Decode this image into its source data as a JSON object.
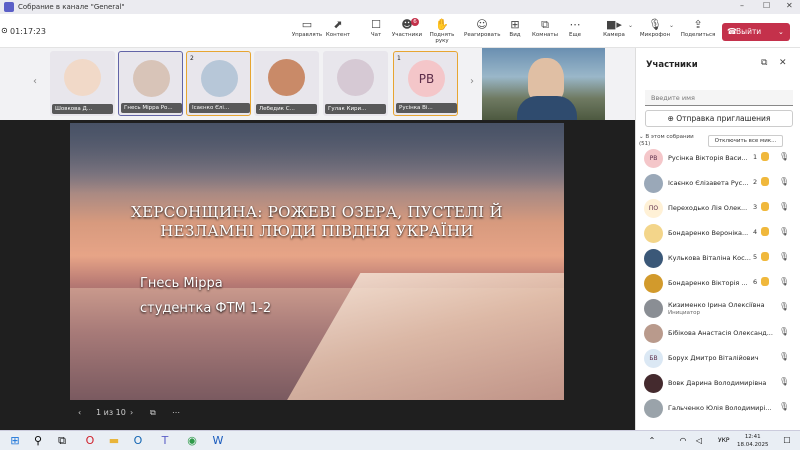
{
  "window": {
    "title": "Собрание в канале \"General\""
  },
  "toolbar": {
    "timer": "01:17:23",
    "items": [
      {
        "label": "Управлять",
        "icon": "monitor-icon"
      },
      {
        "label": "Контент",
        "icon": "share-icon"
      },
      {
        "label": "Чат",
        "icon": "chat-icon"
      },
      {
        "label": "Участники",
        "icon": "people-icon",
        "badge": "6"
      },
      {
        "label": "Поднять руку",
        "icon": "hand-icon"
      },
      {
        "label": "Реагировать",
        "icon": "emoji-icon"
      },
      {
        "label": "Вид",
        "icon": "grid-icon"
      },
      {
        "label": "Комнаты",
        "icon": "rooms-icon"
      },
      {
        "label": "Еще",
        "icon": "more-icon"
      },
      {
        "label": "Камера",
        "icon": "camera-icon"
      },
      {
        "label": "Микрофон",
        "icon": "mic-icon"
      },
      {
        "label": "Поделиться",
        "icon": "upload-icon"
      }
    ],
    "leave_label": "Выйти"
  },
  "strip": {
    "tiles": [
      {
        "name": "Шовкова Д...",
        "hand": "",
        "initials": "",
        "color": "#f1d9c8"
      },
      {
        "name": "Гнесь Мірра Ро...",
        "hand": "",
        "initials": "",
        "color": "#d8c4b8"
      },
      {
        "name": "Ісаєнко Єлі...",
        "hand": "2",
        "initials": "",
        "color": "#b7c7d8"
      },
      {
        "name": "Лебедик С...",
        "hand": "",
        "initials": "",
        "color": "#c98a68"
      },
      {
        "name": "Гулак Кири...",
        "hand": "",
        "initials": "",
        "color": "#d6c9d4"
      },
      {
        "name": "Русінка Ві...",
        "hand": "1",
        "initials": "РВ",
        "color": "#f4c6c9"
      }
    ]
  },
  "slide": {
    "title": "ХЕРСОНЩИНА: РОЖЕВІ ОЗЕРА, ПУСТЕЛІ Й НЕЗЛАМНІ ЛЮДИ ПІВДНЯ УКРАЇНИ",
    "author": "Гнесь Мірра",
    "group": "студентка ФТМ 1-2",
    "page": "1 из 10"
  },
  "panel": {
    "title": "Участники",
    "search_placeholder": "Введите имя",
    "invite_label": "Отправка приглашения",
    "section": "В этом собрании",
    "count": "(51)",
    "mute_all": "Отключить все мик...",
    "people": [
      {
        "name": "Русінка Вікторія Васи...",
        "initials": "РВ",
        "hand": "1",
        "color": "#f4c6c9"
      },
      {
        "name": "Ісаєнко Єлізавета Рус...",
        "initials": "",
        "hand": "2",
        "color": "#9aa8b8"
      },
      {
        "name": "Переходько Лія Олек...",
        "initials": "ПО",
        "hand": "3",
        "color": "#fff1d6"
      },
      {
        "name": "Бондаренко Вероніка...",
        "initials": "",
        "hand": "4",
        "color": "#f3d58a"
      },
      {
        "name": "Кулькова Віталіна Кос...",
        "initials": "",
        "hand": "5",
        "color": "#3b5878"
      },
      {
        "name": "Бондаренко Вікторія ...",
        "initials": "",
        "hand": "6",
        "color": "#d29a2c"
      },
      {
        "name": "Кизименко Ірина Олексіївна",
        "initials": "",
        "hand": "",
        "color": "#8a8e94",
        "role": "Инициатор"
      },
      {
        "name": "Бібікова Анастасія Олександ...",
        "initials": "",
        "hand": "",
        "color": "#b99a8c"
      },
      {
        "name": "Борух Дмитро Віталійович",
        "initials": "БВ",
        "hand": "",
        "color": "#dbe8f4"
      },
      {
        "name": "Вовк Дарина Володимирівна",
        "initials": "",
        "hand": "",
        "color": "#442a2e"
      },
      {
        "name": "Гальченко Юлія Володимирі...",
        "initials": "",
        "hand": "",
        "color": "#9aa3aa"
      }
    ]
  },
  "taskbar": {
    "time": "12:41",
    "date": "18.04.2025",
    "lang": "УКР"
  }
}
